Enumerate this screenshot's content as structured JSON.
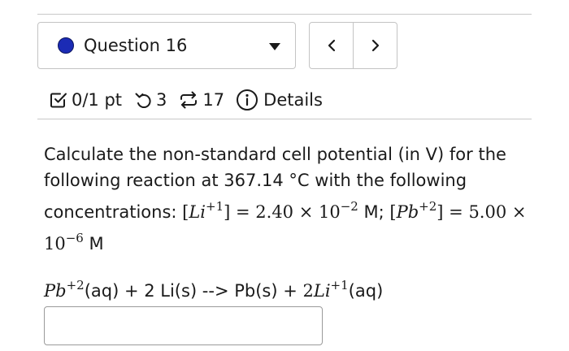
{
  "question_selector": {
    "label": "Question 16",
    "dot_color": "#1b2bb5"
  },
  "nav": {
    "prev_icon": "chevron-left-icon",
    "next_icon": "chevron-right-icon"
  },
  "meta": {
    "score": "0/1 pt",
    "attempts": "3",
    "versions": "17",
    "details_label": "Details"
  },
  "question": {
    "line1": "Calculate the non-standard cell potential (in V) for the following reaction at 367.14 °C with the following concentrations: ",
    "li_ion": "Li",
    "li_charge": "+1",
    "eq1": " = 2.40 × 10",
    "exp1": "−2",
    "unit1": " M; ",
    "pb_ion": "Pb",
    "pb_charge": "+2",
    "eq2": " = 5.00 × 10",
    "exp2": "−6",
    "unit2": " M"
  },
  "reaction": {
    "pb": "Pb",
    "pb_charge": "+2",
    "part1": "(aq) + 2 Li(s) --> Pb(s) + ",
    "coef": "2",
    "li": "Li",
    "li_charge": "+1",
    "part2": "(aq)"
  },
  "answer": {
    "value": "",
    "placeholder": ""
  },
  "colors": {
    "accent_dot": "#1b2bb5",
    "border": "#c4c4c4",
    "text": "#1a1a1a"
  }
}
